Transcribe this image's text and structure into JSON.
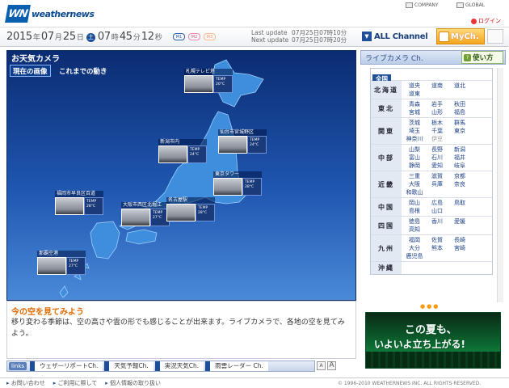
{
  "header": {
    "logo_mark": "WN",
    "logo_text": "weathernews",
    "company": "COMPANY",
    "global": "GLOBAL",
    "login": "ログイン"
  },
  "datebar": {
    "year": "2015",
    "year_unit": "年",
    "month": "07",
    "month_unit": "月",
    "day": "25",
    "day_unit": "日",
    "dow": "土",
    "hour": "07",
    "hour_unit": "時",
    "min": "45",
    "min_unit": "分",
    "sec": "12",
    "sec_unit": "秒",
    "badges": [
      "M1",
      "M2",
      "M3"
    ],
    "last_update_label": "Last update",
    "last_update_value": "07月25日07時10分",
    "next_update_label": "Next update",
    "next_update_value": "07月25日07時20分",
    "all_channel": "ALL Channel",
    "mych": "MyCh."
  },
  "map": {
    "title": "お天気カメラ",
    "tab_now": "現在の画像",
    "tab_history": "これまでの動き",
    "cameras": [
      {
        "label": "札幌テレビ塔",
        "temp": "TEMP\n20°C"
      },
      {
        "label": "新潟市内",
        "temp": "TEMP\n24°C"
      },
      {
        "label": "仙台市宮城野区",
        "temp": "TEMP\n24°C"
      },
      {
        "label": "東京タワー",
        "temp": "TEMP\n28°C"
      },
      {
        "label": "福岡市早良区百道",
        "temp": "TEMP\n28°C"
      },
      {
        "label": "大阪市西区北堀江",
        "temp": "TEMP\n27°C"
      },
      {
        "label": "名古屋駅",
        "temp": "TEMP\n28°C"
      },
      {
        "label": "那覇空港",
        "temp": "TEMP\n27°C"
      }
    ]
  },
  "caption": {
    "title": "今の空を見てみよう",
    "text": "移り変わる季節は、空の高さや雲の形でも感じることが出来ます。ライブカメラで、各地の空を見てみよう。",
    "font_small": "A",
    "font_large": "A",
    "dots": "●●●"
  },
  "links": {
    "label": "links",
    "items": [
      "ウェザーリポートCh.",
      "天気予報Ch.",
      "実況天気Ch.",
      "雨雲レーダー Ch."
    ]
  },
  "live": {
    "title": "ライブカメラ Ch.",
    "howto": "使い方",
    "all": "全国",
    "regions": [
      {
        "name": "北海道",
        "cities": [
          "道央",
          "道南",
          "道北",
          "道東"
        ]
      },
      {
        "name": "東北",
        "cities": [
          "青森",
          "岩手",
          "秋田",
          "宮城",
          "山形",
          "福島"
        ]
      },
      {
        "name": "関東",
        "cities": [
          "茨城",
          "栃木",
          "群馬",
          "埼玉",
          "千葉",
          "東京",
          "神奈川",
          "伊豆"
        ]
      },
      {
        "name": "中部",
        "cities": [
          "山梨",
          "長野",
          "新潟",
          "富山",
          "石川",
          "福井",
          "静岡",
          "愛知",
          "岐阜"
        ]
      },
      {
        "name": "近畿",
        "cities": [
          "三重",
          "滋賀",
          "京都",
          "大阪",
          "兵庫",
          "奈良",
          "和歌山"
        ]
      },
      {
        "name": "中国",
        "cities": [
          "岡山",
          "広島",
          "鳥取",
          "島根",
          "山口"
        ]
      },
      {
        "name": "四国",
        "cities": [
          "徳島",
          "香川",
          "愛媛",
          "高知"
        ]
      },
      {
        "name": "九州",
        "cities": [
          "福岡",
          "佐賀",
          "長崎",
          "大分",
          "熊本",
          "宮崎",
          "鹿児島"
        ]
      },
      {
        "name": "沖縄",
        "cities": []
      }
    ],
    "banner_line1": "この夏も、",
    "banner_line2": "いよいよ立ち上がる!"
  },
  "footer": {
    "links": [
      "お問い合わせ",
      "ご利用に際して",
      "個人情報の取り扱い"
    ],
    "copyright": "© 1996-2010 WEATHERNEWS INC. ALL RIGHTS RESERVED."
  }
}
